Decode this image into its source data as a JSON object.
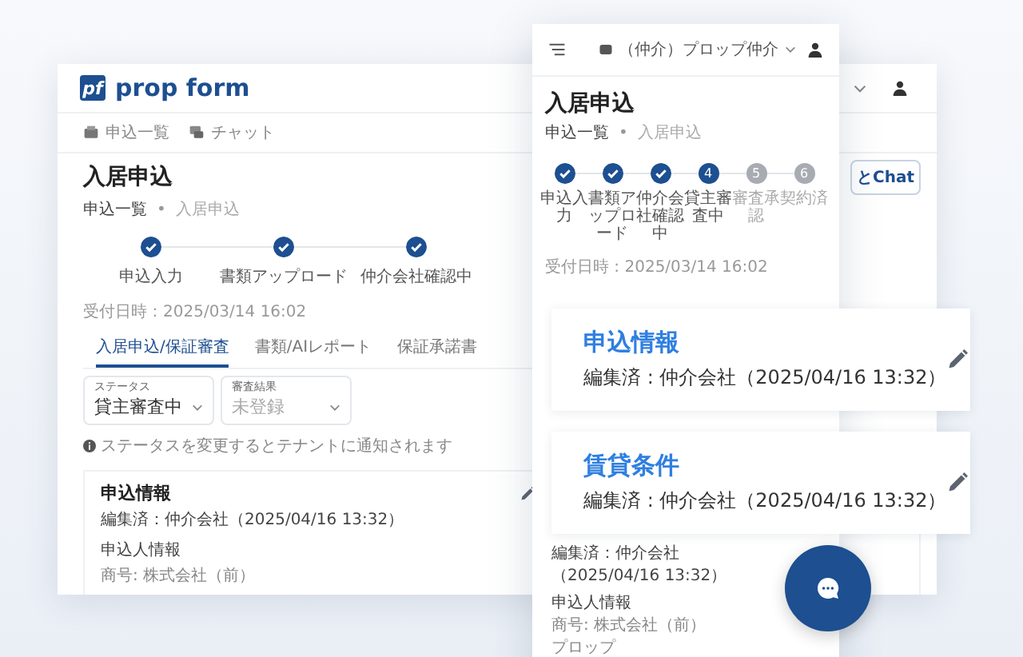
{
  "desktop": {
    "logo": {
      "mark": "pf",
      "name": "prop form"
    },
    "nav": [
      {
        "label": "申込一覧"
      },
      {
        "label": "チャット"
      }
    ],
    "title": "入居申込",
    "breadcrumb": [
      "申込一覧",
      "•",
      "入居申込"
    ],
    "chat_button": "とChat",
    "steps": [
      {
        "label": "申込入力",
        "done": true
      },
      {
        "label": "書類アップロード",
        "done": true
      },
      {
        "label": "仲介会社確認中",
        "done": true
      }
    ],
    "received": "受付日時：2025/03/14 16:02",
    "tabs": [
      {
        "label": "入居申込/保証審査",
        "selected": true
      },
      {
        "label": "書類/AIレポート",
        "selected": false
      },
      {
        "label": "保証承諾書",
        "selected": false
      }
    ],
    "fields": [
      {
        "label": "ステータス",
        "value": "貸主審査中"
      },
      {
        "label": "審査結果",
        "placeholder": "未登録"
      }
    ],
    "notice": "ステータスを変更するとテナントに通知されます",
    "card": {
      "title": "申込情報",
      "edited": "編集済：仲介会社（2025/04/16 13:32）",
      "section": "申込人情報",
      "lines": [
        "商号: 株式会社（前）"
      ]
    }
  },
  "mobile": {
    "company": "（仲介）プロップ仲介",
    "title": "入居申込",
    "breadcrumb": [
      "申込一覧",
      "•",
      "入居申込"
    ],
    "steps": [
      {
        "label": "申込入力",
        "done": true
      },
      {
        "label": "書類アップロード",
        "done": true
      },
      {
        "label": "仲介会社確認中",
        "done": true
      },
      {
        "label": "貸主審査中",
        "done": false,
        "current": true,
        "number": "4"
      },
      {
        "label": "審査承認",
        "done": false,
        "current": false,
        "number": "5"
      },
      {
        "label": "契約済",
        "done": false,
        "current": false,
        "number": "6"
      }
    ],
    "received": "受付日時 : 2025/03/14 16:02",
    "card": {
      "edited": "編集済：仲介会社（2025/04/16 13:32）",
      "section": "申込人情報",
      "lines": [
        "商号: 株式会社（前）",
        "プロップ"
      ]
    }
  },
  "floating_cards": [
    {
      "title": "申込情報",
      "edited": "編集済 : 仲介会社（2025/04/16 13:32）"
    },
    {
      "title": "賃貸条件",
      "edited": "編集済 : 仲介会社（2025/04/16 13:32）"
    }
  ]
}
